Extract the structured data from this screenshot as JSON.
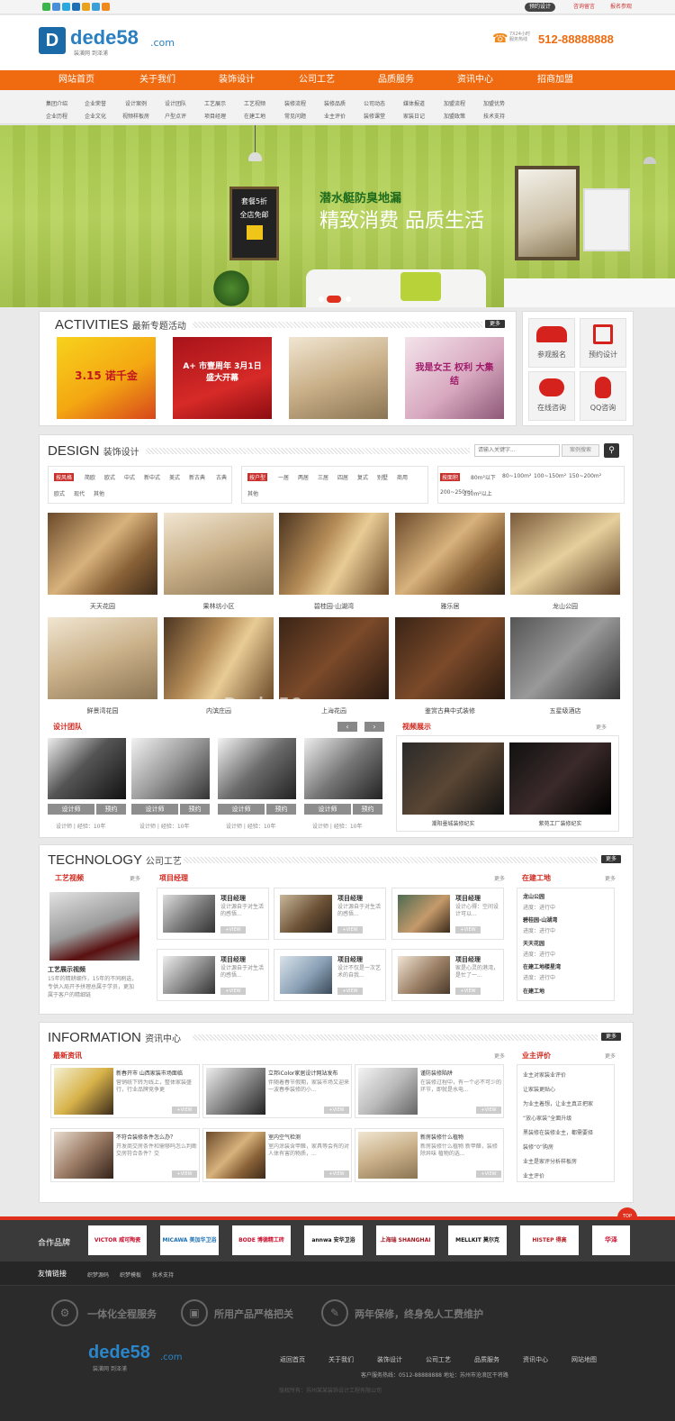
{
  "topbar": {
    "links": [
      "预约设计",
      "咨询留言",
      "报名参观"
    ]
  },
  "header": {
    "logo_text": "dede58",
    "logo_com": ".com",
    "logo_sub": "装潢网 到泽浦",
    "hotline_label": "7X24小时\n服务热线",
    "hotline": "512-88888888"
  },
  "nav": [
    "网站首页",
    "关于我们",
    "装饰设计",
    "公司工艺",
    "品质服务",
    "资讯中心",
    "招商加盟"
  ],
  "subnav": [
    [
      "集团介绍",
      "企业荣誉",
      "企业历程",
      "企业文化"
    ],
    [
      "设计案例",
      "设计团队",
      "视频样板房",
      "户型点评"
    ],
    [
      "工艺展示",
      "工艺视频",
      "项目经理",
      "在建工地"
    ],
    [
      "装修流程",
      "装修品质",
      "常见问题",
      "业主评价"
    ],
    [
      "公司动态",
      "媒体报道",
      "装修课堂",
      "家装日记"
    ],
    [
      "加盟流程",
      "加盟优势",
      "加盟政策",
      "技术支持"
    ]
  ],
  "banner": {
    "slogan1": "潜水艇防臭地漏",
    "slogan2": "精致消费 品质生活",
    "board_line1": "套餐5折",
    "board_line2": "全店免邮"
  },
  "activities": {
    "title": "ACTIVITIES",
    "subtitle": "最新专题活动",
    "more": "更多",
    "posters": [
      "3.15 诺千金",
      "A+ 市壹周年 3月1日 盛大开幕",
      "",
      "我是女王 权利 大集结"
    ],
    "quick": [
      {
        "label": "参观报名",
        "icon": "people-icon"
      },
      {
        "label": "预约设计",
        "icon": "edit-icon"
      },
      {
        "label": "在线咨询",
        "icon": "chat-icon"
      },
      {
        "label": "QQ咨询",
        "icon": "qq-icon"
      }
    ]
  },
  "design": {
    "title": "DESIGN",
    "subtitle": "装饰设计",
    "search_placeholder": "请输入关键字...",
    "search_btn": "案例搜索",
    "style_tag": "按风格",
    "styles": [
      "简欧",
      "欧式",
      "中式",
      "新中式",
      "美式",
      "新古典",
      "古典",
      "欧式",
      "现代",
      "其他"
    ],
    "type_tag": "按户型",
    "types": [
      "一居",
      "两居",
      "三居",
      "四居",
      "复式",
      "别墅",
      "商用",
      "其他"
    ],
    "area_tag": "按面积",
    "areas": [
      "80m²以下",
      "80~100m²",
      "100~150m²",
      "150~200m²",
      "200~250m²",
      "250m²以上"
    ],
    "cases": [
      "天天花园",
      "果林坊小区",
      "碧桂园·山湖湾",
      "雅乐居",
      "龙山公园",
      "鲜景湾花园",
      "内滨庄园",
      "上海花园",
      "鉴赏古典中式装修",
      "五星级酒店"
    ],
    "team_title": "设计团队",
    "video_title": "视频展示",
    "more": "更多",
    "designer_btn": "设计师",
    "book_btn": "预约",
    "designer_meta": [
      "设计师 | 经验：10年",
      "设计师 | 经验：10年",
      "设计师 | 经验：10年",
      "设计师 | 经验：10年"
    ],
    "videos": [
      "潮阳墨城装修纪实",
      "紫苑工厂装修纪实"
    ],
    "watermark": "Dede58.com"
  },
  "technology": {
    "title": "TECHNOLOGY",
    "subtitle": "公司工艺",
    "more": "更多",
    "video_head": "工艺视频",
    "video_more": "更多",
    "video_caption": "工艺展示视频",
    "video_desc": "15年的精耕细作，15年的不同刷选，专供入局开予拼理总属于学员，更加属于客户的精细链",
    "pm_head": "项目经理",
    "pm_more": "更多",
    "pms": [
      {
        "name": "项目经理",
        "desc": "设计源自于对生活的感悟...",
        "btn": "+VIEW"
      },
      {
        "name": "项目经理",
        "desc": "设计源自于对生活的感悟...",
        "btn": "+VIEW"
      },
      {
        "name": "项目经理",
        "desc": "设计心得：空间设计可以...",
        "btn": "+VIEW"
      },
      {
        "name": "项目经理",
        "desc": "设计源自于对生活的感悟...",
        "btn": "+VIEW"
      },
      {
        "name": "项目经理",
        "desc": "设计不仅是一次艺术的自我...",
        "btn": "+VIEW"
      },
      {
        "name": "项目经理",
        "desc": "家是心灵的港湾，是忙了一...",
        "btn": "+VIEW"
      }
    ],
    "site_head": "在建工地",
    "site_more": "更多",
    "sites": [
      {
        "name": "龙山公园",
        "status": "进度：进行中"
      },
      {
        "name": "碧桂园·山湖湾",
        "status": "进度：进行中"
      },
      {
        "name": "天天花园",
        "status": "进度：进行中"
      },
      {
        "name": "在建工地楼星湾",
        "status": "进度：进行中"
      },
      {
        "name": "在建工地",
        "status": ""
      }
    ]
  },
  "information": {
    "title": "INFORMATION",
    "subtitle": "资讯中心",
    "more": "更多",
    "news_head": "最新资讯",
    "news_more": "更多",
    "news": [
      {
        "t": "新春开市 山西家装市场面临",
        "d": "营销统下转为线上，整体家装盛行，行业品牌竞争更",
        "btn": "+VIEW"
      },
      {
        "t": "立邦iColor家居设计网站发布",
        "d": "伴随着春节假期，家装市场又迎来一波春季装修的小...",
        "btn": "+VIEW"
      },
      {
        "t": "谨防装修陷阱",
        "d": "在装修过程中，有一个必不可少的环节，即就是水电...",
        "btn": "+VIEW"
      },
      {
        "t": "不符合装修条件怎么办？",
        "d": "开发商交房条件和需够吗怎么判断 交房符合条件？交",
        "btn": "+VIEW"
      },
      {
        "t": "室内空气检测",
        "d": "室内涂装含甲醛，家具等会有的对人体有害的物质，...",
        "btn": "+VIEW"
      },
      {
        "t": "新房装修什么植物",
        "d": "新房装修什么植物 新甲醛，装修除异味 植物的选...",
        "btn": "+VIEW"
      }
    ],
    "review_head": "业主评价",
    "review_more": "更多",
    "reviews": [
      "业主对家装业评价",
      "让家装更贴心",
      "为业主着想，让业主真正把家",
      "“放心家装”全面升级",
      "黑装修在装修业主，都需要择",
      "装修“0”购房",
      "业主是家评分析样板房",
      "业主评价"
    ]
  },
  "partners": {
    "label": "合作品牌",
    "brands": [
      "VICTOR 威可陶瓷",
      "MICAWA 美加华卫浴",
      "BODE 博德精工砖",
      "annwa 安华卫浴",
      "上海瑞 SHANGHAI JUHAI",
      "MELLKIT 莫尔克",
      "HISTEP 得高",
      "华泽"
    ]
  },
  "links": {
    "label": "友情链接",
    "items": [
      "织梦源码",
      "织梦模板",
      "技术支持"
    ]
  },
  "promises": [
    "一体化全程服务",
    "所用产品严格把关",
    "两年保修，终身免人工费维护"
  ],
  "footer": {
    "nav": [
      "返回首页",
      "关于我们",
      "装饰设计",
      "公司工艺",
      "品质服务",
      "资讯中心",
      "网站地图"
    ],
    "contact": "客户服务热线：0512-88888888  地址：苏州市沧浪区干将路",
    "copyright": "版权所有：苏州某某装饰设计工程有限公司",
    "top": "TOP",
    "logo": "dede58",
    ".com": ".com",
    "logo_sub": "装潢网 到泽浦"
  },
  "colors": {
    "orange": "#f06b10",
    "red": "#d0281e",
    "dark": "#2b2b2b"
  }
}
